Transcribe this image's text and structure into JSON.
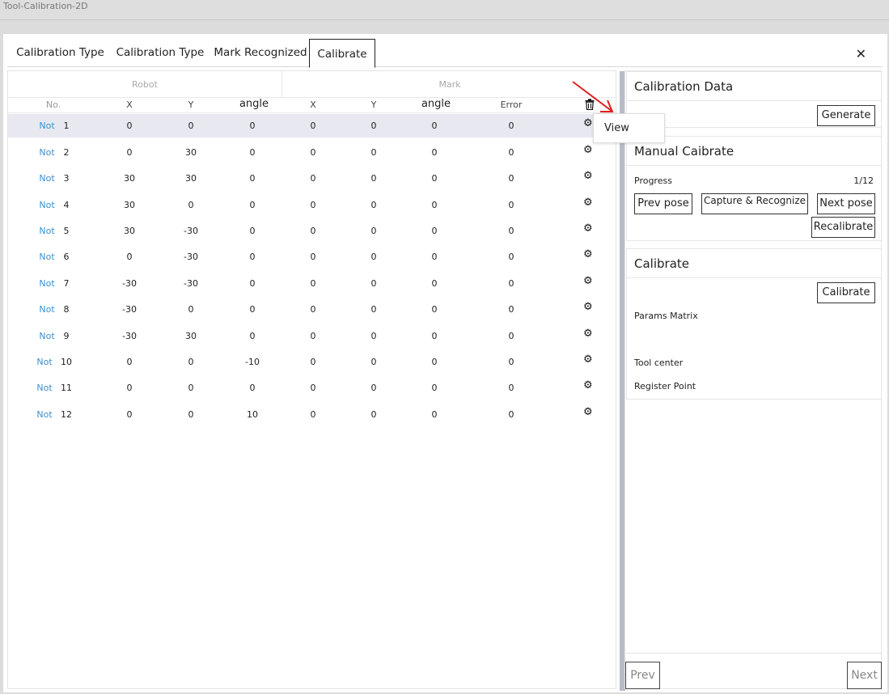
{
  "window": {
    "title": "Tool-Calibration-2D"
  },
  "tabs": [
    {
      "label": "Calibration Type"
    },
    {
      "label": "Calibration Type"
    },
    {
      "label": "Mark Recognized"
    },
    {
      "label": "Calibrate"
    }
  ],
  "close_glyph": "✕",
  "table": {
    "group_robot": "Robot",
    "group_mark": "Mark",
    "headers": {
      "no": "No.",
      "rx": "X",
      "ry": "Y",
      "rangle": "angle",
      "mx": "X",
      "my": "Y",
      "mangle": "angle",
      "error": "Error"
    },
    "rows": [
      {
        "status": "Not",
        "no": "1",
        "rx": "0",
        "ry": "0",
        "rangle": "0",
        "mx": "0",
        "my": "0",
        "mangle": "0",
        "error": "0"
      },
      {
        "status": "Not",
        "no": "2",
        "rx": "0",
        "ry": "30",
        "rangle": "0",
        "mx": "0",
        "my": "0",
        "mangle": "0",
        "error": "0"
      },
      {
        "status": "Not",
        "no": "3",
        "rx": "30",
        "ry": "30",
        "rangle": "0",
        "mx": "0",
        "my": "0",
        "mangle": "0",
        "error": "0"
      },
      {
        "status": "Not",
        "no": "4",
        "rx": "30",
        "ry": "0",
        "rangle": "0",
        "mx": "0",
        "my": "0",
        "mangle": "0",
        "error": "0"
      },
      {
        "status": "Not",
        "no": "5",
        "rx": "30",
        "ry": "-30",
        "rangle": "0",
        "mx": "0",
        "my": "0",
        "mangle": "0",
        "error": "0"
      },
      {
        "status": "Not",
        "no": "6",
        "rx": "0",
        "ry": "-30",
        "rangle": "0",
        "mx": "0",
        "my": "0",
        "mangle": "0",
        "error": "0"
      },
      {
        "status": "Not",
        "no": "7",
        "rx": "-30",
        "ry": "-30",
        "rangle": "0",
        "mx": "0",
        "my": "0",
        "mangle": "0",
        "error": "0"
      },
      {
        "status": "Not",
        "no": "8",
        "rx": "-30",
        "ry": "0",
        "rangle": "0",
        "mx": "0",
        "my": "0",
        "mangle": "0",
        "error": "0"
      },
      {
        "status": "Not",
        "no": "9",
        "rx": "-30",
        "ry": "30",
        "rangle": "0",
        "mx": "0",
        "my": "0",
        "mangle": "0",
        "error": "0"
      },
      {
        "status": "Not",
        "no": "10",
        "rx": "0",
        "ry": "0",
        "rangle": "-10",
        "mx": "0",
        "my": "0",
        "mangle": "0",
        "error": "0"
      },
      {
        "status": "Not",
        "no": "11",
        "rx": "0",
        "ry": "0",
        "rangle": "0",
        "mx": "0",
        "my": "0",
        "mangle": "0",
        "error": "0"
      },
      {
        "status": "Not",
        "no": "12",
        "rx": "0",
        "ry": "0",
        "rangle": "10",
        "mx": "0",
        "my": "0",
        "mangle": "0",
        "error": "0"
      }
    ]
  },
  "context_menu": {
    "view_label": "View"
  },
  "calibration_data": {
    "title": "Calibration Data",
    "generate_label": "Generate"
  },
  "manual_calibrate": {
    "title": "Manual Caibrate",
    "progress_label": "Progress",
    "progress_value": "1/12",
    "prev_pose_label": "Prev pose",
    "capture_label": "Capture & Recognize",
    "next_pose_label": "Next pose",
    "recalibrate_label": "Recalibrate"
  },
  "calibrate": {
    "title": "Calibrate",
    "calibrate_label": "Calibrate",
    "params_matrix_label": "Params Matrix",
    "tool_center_label": "Tool center",
    "register_point_label": "Register Point"
  },
  "footer": {
    "prev_label": "Prev",
    "next_label": "Next"
  },
  "colors": {
    "accent_link": "#3a8fd0",
    "scrollbar": "#b8bcc9",
    "selected_row": "#e8e9f0",
    "annotation_arrow": "#e02020"
  }
}
